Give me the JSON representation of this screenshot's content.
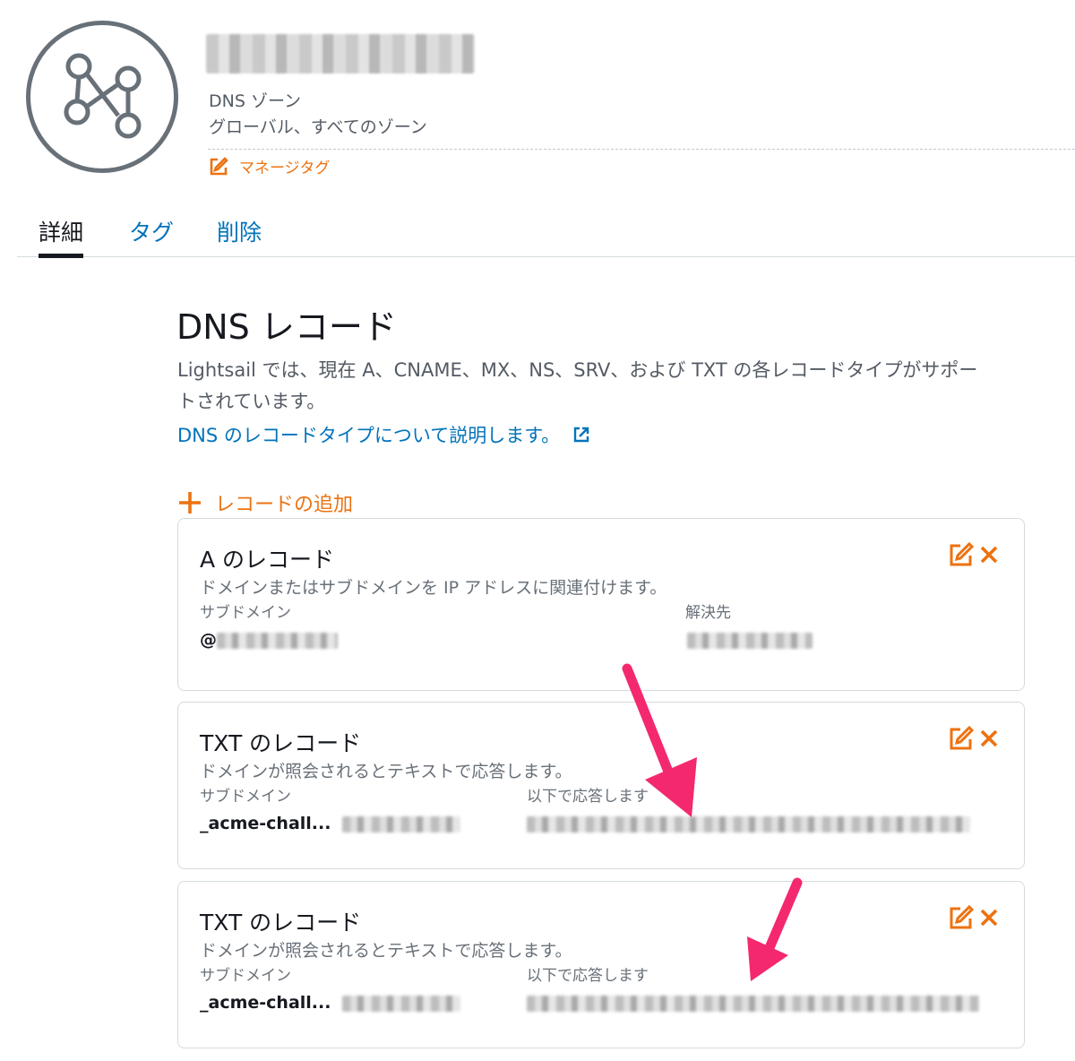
{
  "header": {
    "zone_name": "",
    "zone_type": "DNS ゾーン",
    "zone_scope": "グローバル、すべてのゾーン",
    "manage_tags_label": "マネージタグ"
  },
  "tabs": [
    {
      "label": "詳細",
      "active": true
    },
    {
      "label": "タグ",
      "active": false
    },
    {
      "label": "削除",
      "active": false
    }
  ],
  "section": {
    "title": "DNS レコード",
    "description": "Lightsail では、現在 A、CNAME、MX、NS、SRV、および TXT の各レコードタイプがサポートされています。",
    "learn_link": "DNS のレコードタイプについて説明します。",
    "add_record_label": "レコードの追加"
  },
  "records": [
    {
      "title": "A のレコード",
      "description": "ドメインまたはサブドメインを IP アドレスに関連付けます。",
      "col1_label": "サブドメイン",
      "col1_value": "@",
      "col2_label": "解決先"
    },
    {
      "title": "TXT のレコード",
      "description": "ドメインが照会されるとテキストで応答します。",
      "col1_label": "サブドメイン",
      "col1_value": "_acme-chall...",
      "col2_label": "以下で応答します"
    },
    {
      "title": "TXT のレコード",
      "description": "ドメインが照会されるとテキストで応答します。",
      "col1_label": "サブドメイン",
      "col1_value": "_acme-chall...",
      "col2_label": "以下で応答します"
    }
  ],
  "colors": {
    "accent_orange": "#ec7211",
    "link_blue": "#0073bb",
    "annotation_pink": "#f4286f"
  }
}
